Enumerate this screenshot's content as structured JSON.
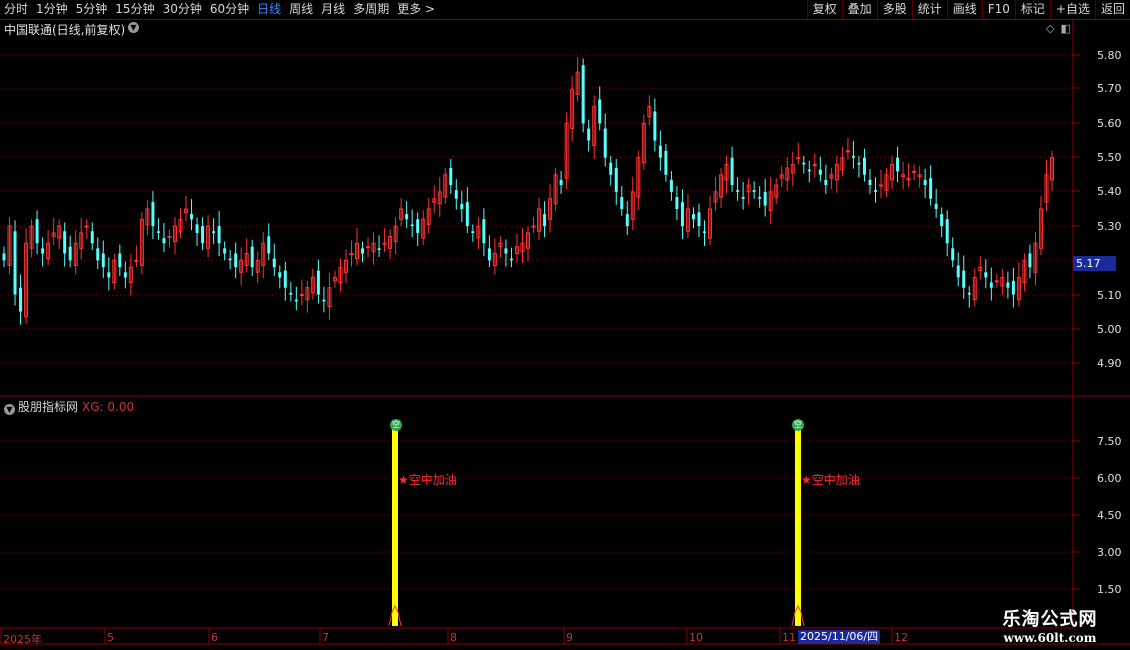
{
  "toolbar": {
    "periods": [
      "分时",
      "1分钟",
      "5分钟",
      "15分钟",
      "30分钟",
      "60分钟",
      "日线",
      "周线",
      "月线",
      "多周期",
      "更多 >"
    ],
    "active_period": "日线",
    "actions": [
      "复权",
      "叠加",
      "多股",
      "统计",
      "画线",
      "F10",
      "标记",
      "+自选",
      "返回"
    ]
  },
  "main_chart": {
    "title": "中国联通(日线,前复权)",
    "y_ticks": [
      "5.80",
      "5.70",
      "5.60",
      "5.50",
      "5.40",
      "5.30",
      "5.20",
      "5.10",
      "5.00",
      "4.90"
    ],
    "current_price": "5.17"
  },
  "indicator": {
    "name": "股朋指标网",
    "xg_label": "XG: 0.00",
    "y_ticks": [
      "7.50",
      "6.00",
      "4.50",
      "3.00",
      "1.50"
    ],
    "signals": [
      {
        "label": "★空中加油",
        "icon_text": "空"
      },
      {
        "label": "★空中加油",
        "icon_text": "空"
      }
    ]
  },
  "time_axis": {
    "labels": [
      "2025年",
      "5",
      "6",
      "7",
      "8",
      "9",
      "10",
      "11",
      "12"
    ],
    "cursor_date": "2025/11/06/四"
  },
  "watermark": {
    "main": "乐淘公式网",
    "sub": "www.60lt.com"
  },
  "colors": {
    "up": "#ff3232",
    "down": "#54ffff",
    "signal_bar": "#ffff00",
    "grid": "#8b0000"
  }
}
